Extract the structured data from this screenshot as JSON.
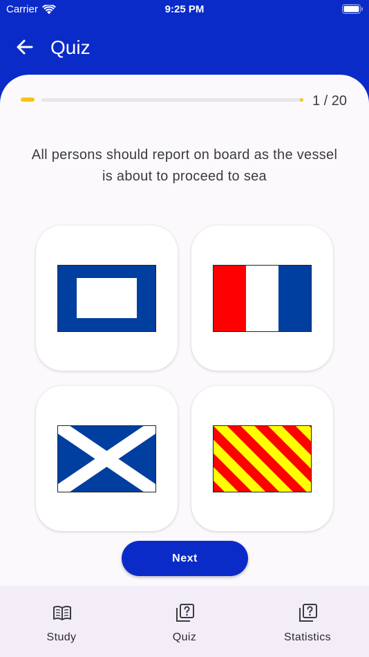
{
  "status_bar": {
    "carrier": "Carrier",
    "time": "9:25 PM"
  },
  "app_bar": {
    "title": "Quiz",
    "back_icon": "arrow-left-icon"
  },
  "progress": {
    "current": 1,
    "total": 20,
    "label": "1 / 20",
    "fraction": 0.05
  },
  "question": "All persons should report on board as the vessel is about to proceed to sea",
  "options": [
    {
      "flag_icon": "flag-blue-white-square-icon"
    },
    {
      "flag_icon": "flag-red-white-blue-vertical-icon"
    },
    {
      "flag_icon": "flag-white-saltire-on-blue-icon"
    },
    {
      "flag_icon": "flag-yellow-red-diagonal-stripes-icon"
    }
  ],
  "next_button": {
    "label": "Next"
  },
  "nav": [
    {
      "label": "Study",
      "icon": "open-book-icon"
    },
    {
      "label": "Quiz",
      "icon": "quiz-icon"
    },
    {
      "label": "Statistics",
      "icon": "quiz-icon"
    }
  ],
  "colors": {
    "primary": "#0b2bc9",
    "progress": "#f5c518",
    "flag_blue": "#003f9f",
    "flag_red": "#ff0000",
    "flag_yellow": "#ffff00"
  }
}
